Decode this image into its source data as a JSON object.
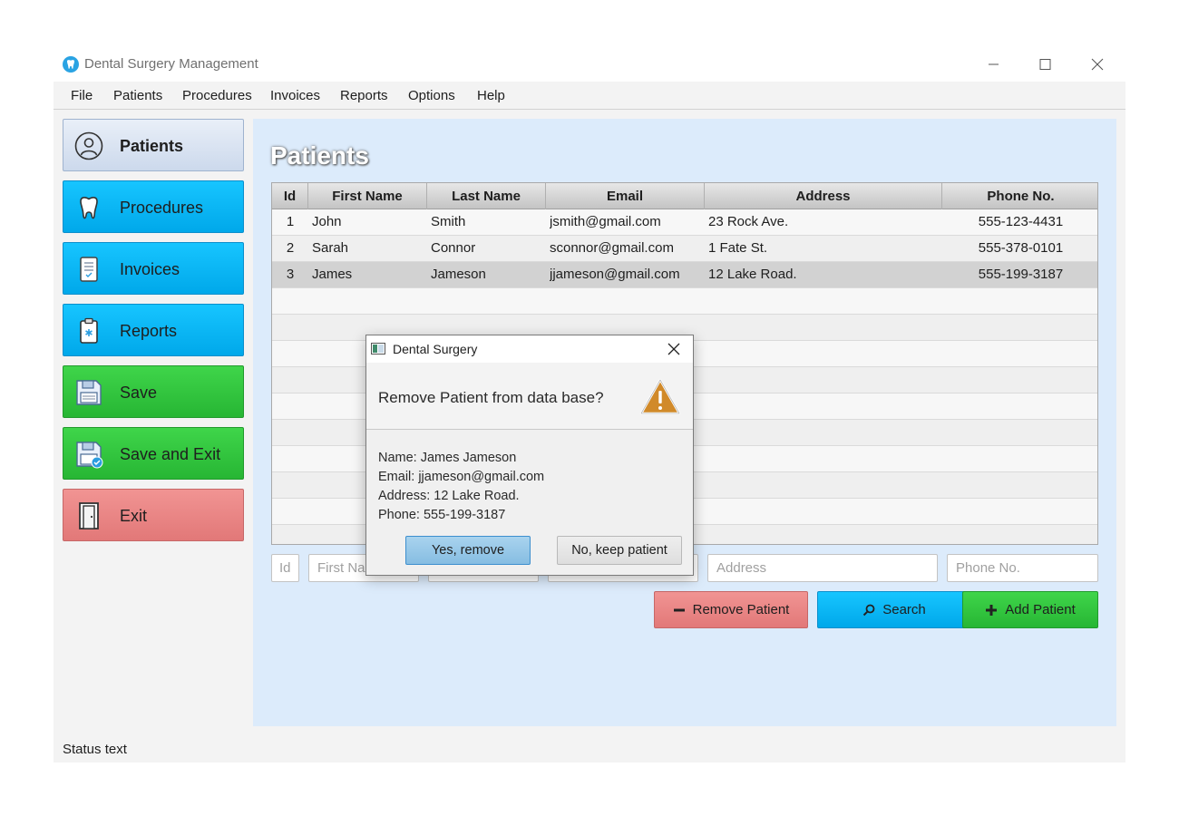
{
  "app": {
    "title": "Dental Surgery Management"
  },
  "menu": [
    "File",
    "Patients",
    "Procedures",
    "Invoices",
    "Reports",
    "Options",
    "Help"
  ],
  "sidebar": {
    "items": [
      {
        "label": "Patients",
        "icon": "user-circle-icon"
      },
      {
        "label": "Procedures",
        "icon": "tooth-icon"
      },
      {
        "label": "Invoices",
        "icon": "invoice-icon"
      },
      {
        "label": "Reports",
        "icon": "clipboard-icon"
      },
      {
        "label": "Save",
        "icon": "floppy-disk-icon"
      },
      {
        "label": "Save and Exit",
        "icon": "floppy-check-icon"
      },
      {
        "label": "Exit",
        "icon": "door-icon"
      }
    ]
  },
  "main": {
    "title": "Patients",
    "table": {
      "columns": [
        "Id",
        "First Name",
        "Last Name",
        "Email",
        "Address",
        "Phone No."
      ],
      "rows": [
        [
          "1",
          "John",
          "Smith",
          "jsmith@gmail.com",
          "23 Rock Ave.",
          "555-123-4431"
        ],
        [
          "2",
          "Sarah",
          "Connor",
          "sconnor@gmail.com",
          "1 Fate St.",
          "555-378-0101"
        ],
        [
          "3",
          "James",
          "Jameson",
          "jjameson@gmail.com",
          "12 Lake Road.",
          "555-199-3187"
        ]
      ],
      "selected_row": 3
    },
    "fields": {
      "id_placeholder": "Id",
      "first_name_placeholder": "First Name",
      "last_name_placeholder": "",
      "email_placeholder": "",
      "address_placeholder": "Address",
      "phone_placeholder": "Phone No."
    },
    "actions": {
      "remove": "Remove Patient",
      "search": "Search",
      "add": "Add Patient"
    }
  },
  "dialog": {
    "title": "Dental Surgery",
    "question": "Remove Patient from data base?",
    "details": [
      "Name: James Jameson",
      "Email: jjameson@gmail.com",
      "Address: 12 Lake Road.",
      "Phone: 555-199-3187"
    ],
    "yes_label": "Yes, remove",
    "no_label": "No, keep patient"
  },
  "status": {
    "text": "Status text"
  },
  "colors": {
    "content_bg": "#dcebfb",
    "blue_button": "#00b4f5",
    "green_button": "#2fc23b",
    "red_button": "#e88585"
  }
}
